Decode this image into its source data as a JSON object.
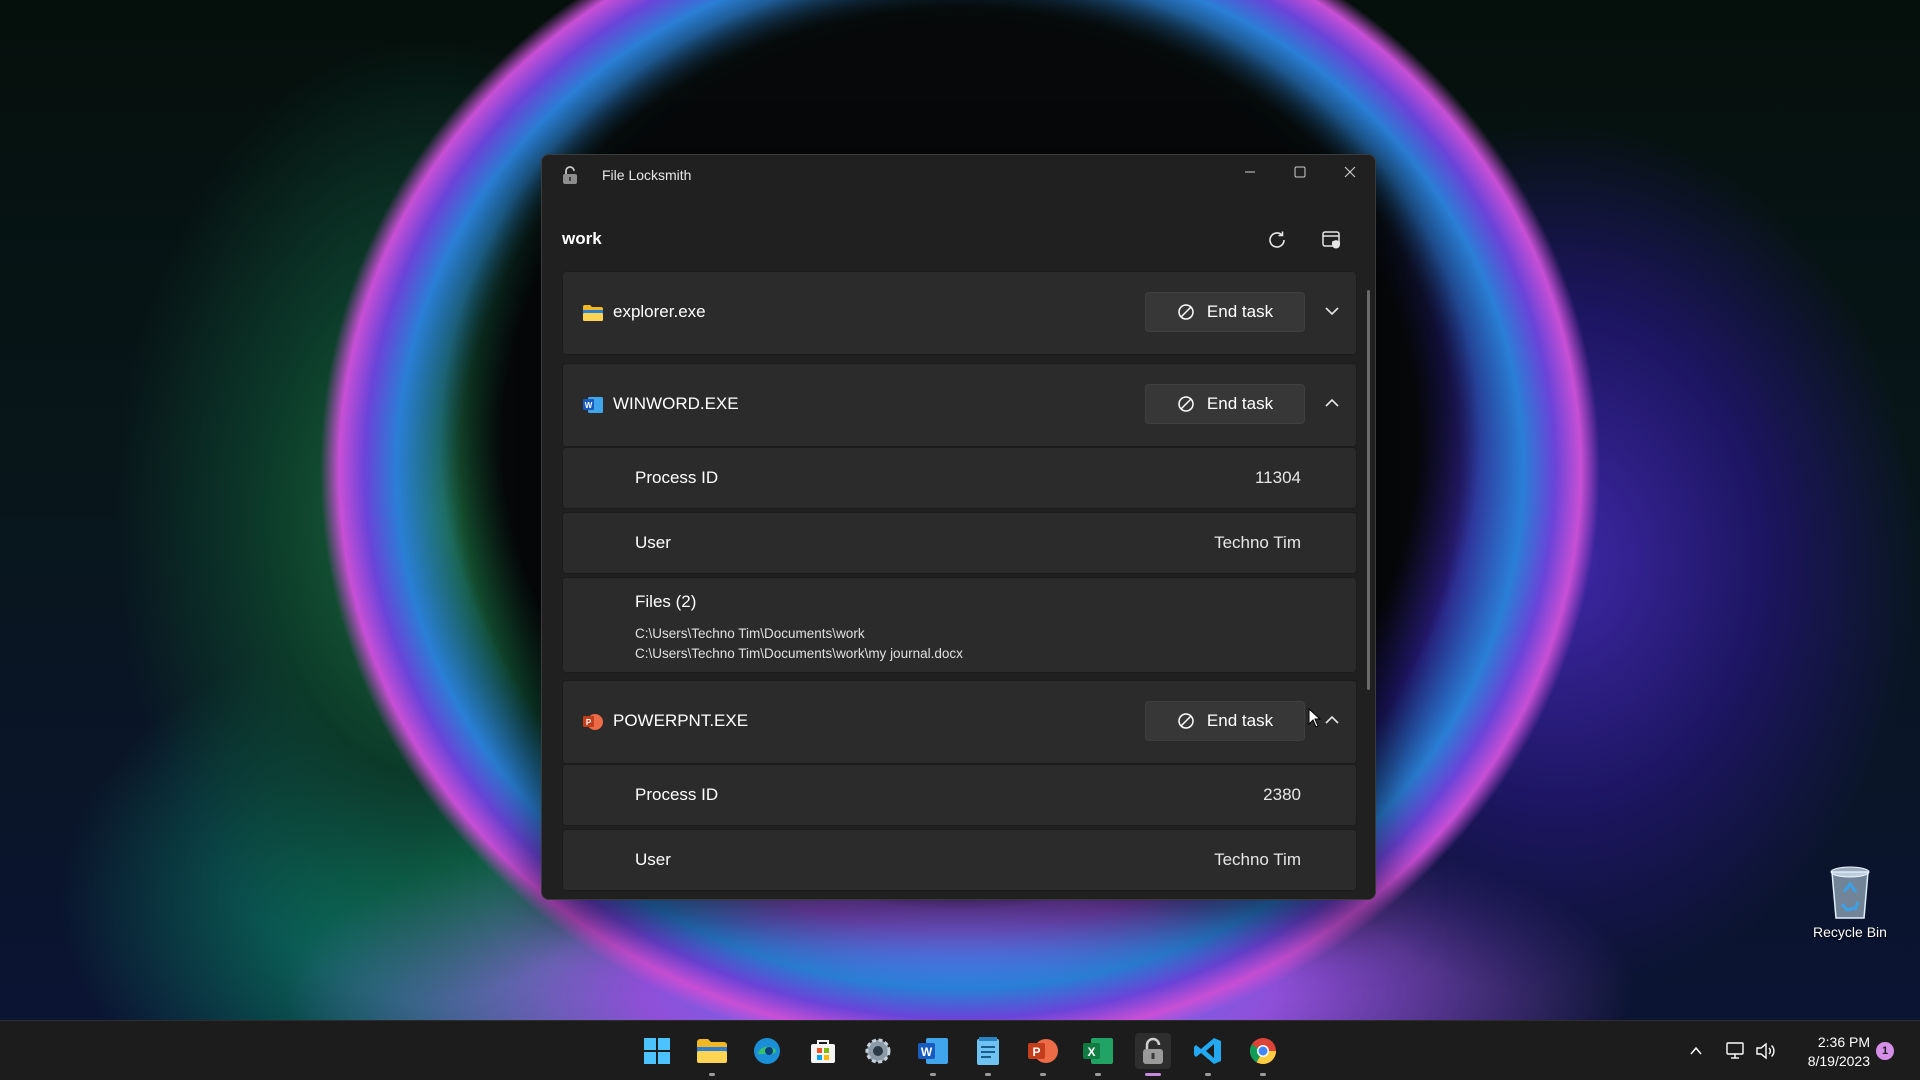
{
  "window": {
    "title": "File Locksmith",
    "header": "work"
  },
  "processes": [
    {
      "name": "explorer.exe",
      "icon": "folder-icon",
      "expanded": false,
      "end_task_label": "End task"
    },
    {
      "name": "WINWORD.EXE",
      "icon": "word-icon",
      "expanded": true,
      "end_task_label": "End task",
      "process_id_label": "Process ID",
      "process_id": "11304",
      "user_label": "User",
      "user": "Techno Tim",
      "files_label": "Files (2)",
      "files": [
        "C:\\Users\\Techno Tim\\Documents\\work",
        "C:\\Users\\Techno Tim\\Documents\\work\\my journal.docx"
      ]
    },
    {
      "name": "POWERPNT.EXE",
      "icon": "powerpoint-icon",
      "expanded": true,
      "end_task_label": "End task",
      "process_id_label": "Process ID",
      "process_id": "2380",
      "user_label": "User",
      "user": "Techno Tim"
    }
  ],
  "desktop": {
    "recycle_bin_label": "Recycle Bin"
  },
  "taskbar": {
    "apps": [
      "start-icon",
      "file-explorer-icon",
      "edge-icon",
      "store-icon",
      "settings-icon",
      "word-icon",
      "notepad-icon",
      "powerpoint-icon",
      "excel-icon",
      "file-locksmith-icon",
      "vscode-icon",
      "chrome-icon"
    ],
    "time": "2:36 PM",
    "date": "8/19/2023",
    "notification_count": "1"
  },
  "colors": {
    "window_bg": "#202020",
    "card_bg": "#2b2b2b",
    "button_bg": "#373737",
    "accent_active": "#c48bdc"
  }
}
